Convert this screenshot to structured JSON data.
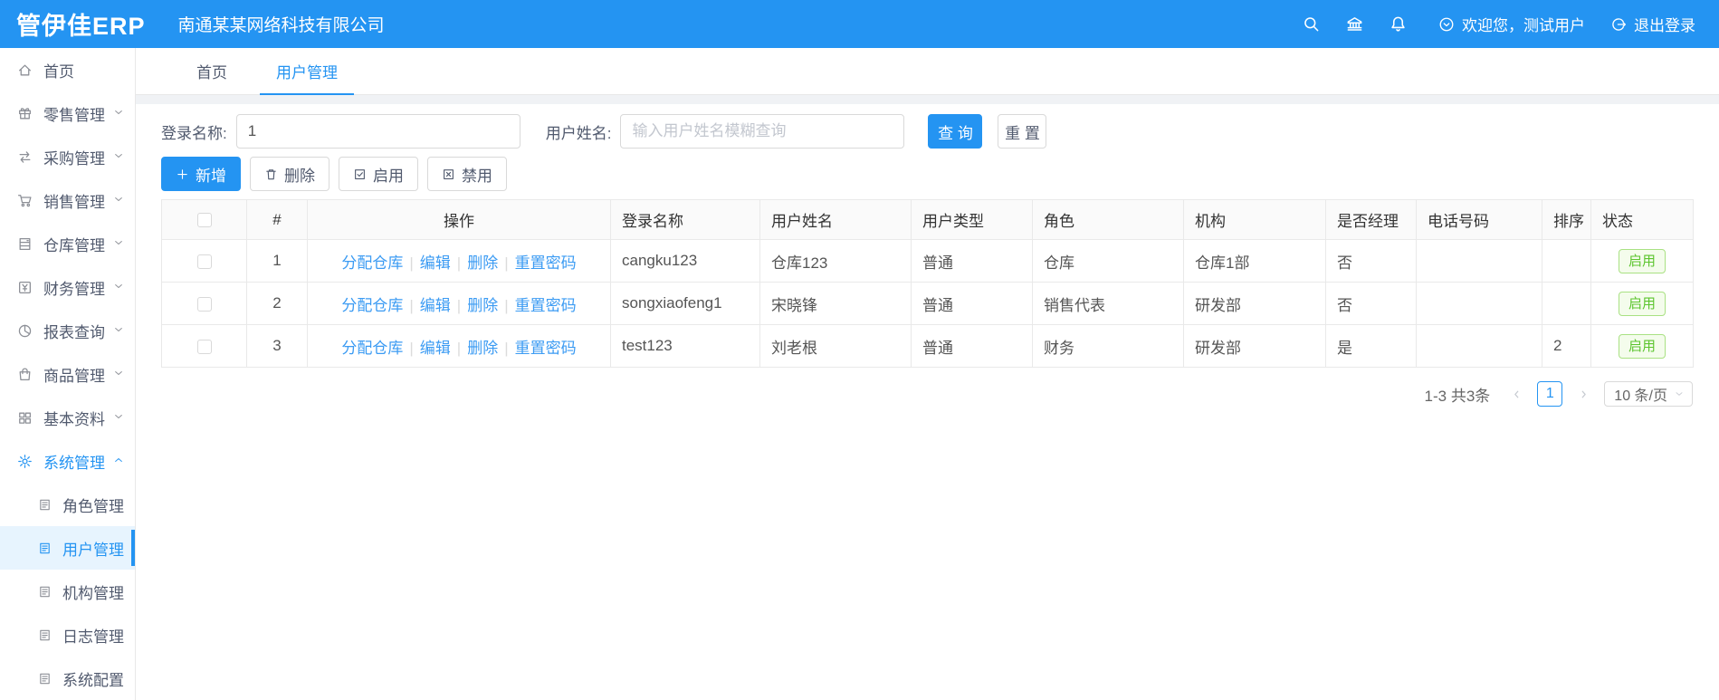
{
  "header": {
    "logo": "管伊佳ERP",
    "company": "南通某某网络科技有限公司",
    "welcome": "欢迎您，测试用户",
    "logout": "退出登录",
    "accent_color": "#2494f2"
  },
  "sidebar": {
    "items": [
      {
        "label": "首页",
        "icon": "home",
        "level": 1,
        "chevron": "",
        "active": false
      },
      {
        "label": "零售管理",
        "icon": "gift",
        "level": 1,
        "chevron": "down",
        "active": false
      },
      {
        "label": "采购管理",
        "icon": "swap",
        "level": 1,
        "chevron": "down",
        "active": false
      },
      {
        "label": "销售管理",
        "icon": "cart",
        "level": 1,
        "chevron": "down",
        "active": false
      },
      {
        "label": "仓库管理",
        "icon": "cabinet",
        "level": 1,
        "chevron": "down",
        "active": false
      },
      {
        "label": "财务管理",
        "icon": "finance",
        "level": 1,
        "chevron": "down",
        "active": false
      },
      {
        "label": "报表查询",
        "icon": "pie",
        "level": 1,
        "chevron": "down",
        "active": false
      },
      {
        "label": "商品管理",
        "icon": "bag",
        "level": 1,
        "chevron": "down",
        "active": false
      },
      {
        "label": "基本资料",
        "icon": "grid",
        "level": 1,
        "chevron": "down",
        "active": false
      },
      {
        "label": "系统管理",
        "icon": "gear",
        "level": 1,
        "chevron": "up",
        "active": false,
        "parentActive": true
      },
      {
        "label": "角色管理",
        "icon": "doc",
        "level": 2,
        "chevron": "",
        "active": false
      },
      {
        "label": "用户管理",
        "icon": "doc",
        "level": 2,
        "chevron": "",
        "active": true
      },
      {
        "label": "机构管理",
        "icon": "doc",
        "level": 2,
        "chevron": "",
        "active": false
      },
      {
        "label": "日志管理",
        "icon": "doc",
        "level": 2,
        "chevron": "",
        "active": false
      },
      {
        "label": "系统配置",
        "icon": "doc",
        "level": 2,
        "chevron": "",
        "active": false
      }
    ]
  },
  "tabs": [
    {
      "label": "首页",
      "active": false
    },
    {
      "label": "用户管理",
      "active": true
    }
  ],
  "filter": {
    "login_label": "登录名称:",
    "login_value": "1",
    "name_label": "用户姓名:",
    "name_placeholder": "输入用户姓名模糊查询",
    "search_label": "查 询",
    "reset_label": "重 置"
  },
  "toolbar": {
    "add_label": "新增",
    "delete_label": "删除",
    "enable_label": "启用",
    "disable_label": "禁用"
  },
  "table": {
    "columns": [
      "#",
      "操作",
      "登录名称",
      "用户姓名",
      "用户类型",
      "角色",
      "机构",
      "是否经理",
      "电话号码",
      "排序",
      "状态"
    ],
    "action_links": [
      "分配仓库",
      "编辑",
      "删除",
      "重置密码"
    ],
    "rows": [
      {
        "index": "1",
        "login": "cangku123",
        "name": "仓库123",
        "type": "普通",
        "role": "仓库",
        "org": "仓库1部",
        "manager": "否",
        "phone": "",
        "sort": "",
        "status": "启用"
      },
      {
        "index": "2",
        "login": "songxiaofeng1",
        "name": "宋晓锋",
        "type": "普通",
        "role": "销售代表",
        "org": "研发部",
        "manager": "否",
        "phone": "",
        "sort": "",
        "status": "启用"
      },
      {
        "index": "3",
        "login": "test123",
        "name": "刘老根",
        "type": "普通",
        "role": "财务",
        "org": "研发部",
        "manager": "是",
        "phone": "",
        "sort": "2",
        "status": "启用"
      }
    ],
    "status_colors": {
      "enabled_text": "#5cc52e",
      "enabled_border": "#a9e183",
      "enabled_bg": "#f4fcec"
    }
  },
  "pagination": {
    "summary": "1-3 共3条",
    "current_page": "1",
    "page_size": "10 条/页"
  }
}
